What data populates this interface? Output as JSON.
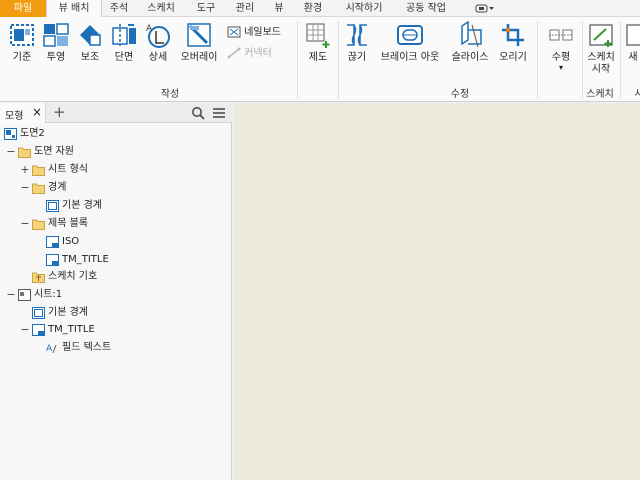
{
  "tabs": [
    {
      "label": "파일"
    },
    {
      "label": "뷰 배치"
    },
    {
      "label": "주석"
    },
    {
      "label": "스케치"
    },
    {
      "label": "도구"
    },
    {
      "label": "관리"
    },
    {
      "label": "뷰"
    },
    {
      "label": "환경"
    },
    {
      "label": "시작하기"
    },
    {
      "label": "공동 작업"
    }
  ],
  "ribbon": {
    "create": {
      "panel_label": "작성",
      "buttons": [
        "기준",
        "투영",
        "보조",
        "단면",
        "상세",
        "오버레이"
      ],
      "small_buttons": [
        "네일보드",
        "커넥터"
      ]
    },
    "base": {
      "label": "제도"
    },
    "modify": {
      "panel_label": "수정",
      "buttons": [
        "끊기",
        "브레이크 아웃",
        "슬라이스",
        "오리기"
      ]
    },
    "align": {
      "label": "수평"
    },
    "sketch": {
      "panel_label": "스케치",
      "button_line1": "스케치",
      "button_line2": "시작"
    },
    "cut_label": "새",
    "cut_panel": "시"
  },
  "browser": {
    "tab_label": "모형",
    "tree": [
      {
        "label": "도면2",
        "icon": "drawing-icon",
        "exp": ""
      },
      {
        "label": "도면 자원",
        "icon": "folder-icon",
        "exp": "−"
      },
      {
        "label": "시트 형식",
        "icon": "folder-icon",
        "exp": "+"
      },
      {
        "label": "경계",
        "icon": "folder-icon",
        "exp": "−"
      },
      {
        "label": "기본 경계",
        "icon": "border-icon",
        "exp": ""
      },
      {
        "label": "제목 블록",
        "icon": "folder-icon",
        "exp": "−"
      },
      {
        "label": "ISO",
        "icon": "title-block-icon",
        "exp": ""
      },
      {
        "label": "TM_TITLE",
        "icon": "title-block-icon",
        "exp": ""
      },
      {
        "label": "스케치 기호",
        "icon": "symbol-folder-icon",
        "exp": ""
      },
      {
        "label": "시트:1",
        "icon": "sheet-icon",
        "exp": "−"
      },
      {
        "label": "기본 경계",
        "icon": "border-icon",
        "exp": ""
      },
      {
        "label": "TM_TITLE",
        "icon": "title-block-icon",
        "exp": "−"
      },
      {
        "label": "필드 텍스트",
        "icon": "field-text-icon",
        "exp": ""
      }
    ]
  },
  "colors": {
    "file_tab": "#f39c12",
    "canvas": "#ece9dd",
    "icon_blue": "#1d6fb8"
  }
}
